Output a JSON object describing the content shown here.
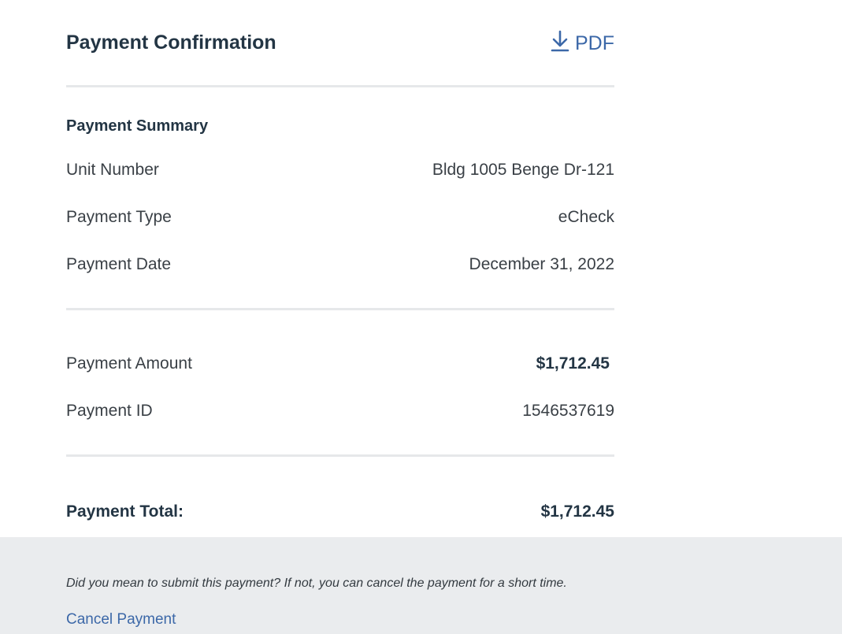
{
  "header": {
    "title": "Payment Confirmation",
    "pdf_label": "PDF"
  },
  "summary": {
    "section_title": "Payment Summary",
    "rows": [
      {
        "label": "Unit Number",
        "value": "Bldg 1005 Benge Dr-121"
      },
      {
        "label": "Payment Type",
        "value": "eCheck"
      },
      {
        "label": "Payment Date",
        "value": "December 31, 2022"
      }
    ]
  },
  "amounts": {
    "rows": [
      {
        "label": "Payment Amount",
        "value": "$1,712.45"
      },
      {
        "label": "Payment ID",
        "value": "1546537619"
      }
    ]
  },
  "total": {
    "label": "Payment Total:",
    "value": "$1,712.45"
  },
  "footer": {
    "note": "Did you mean to submit this payment? If not, you can cancel the payment for a short time.",
    "cancel_label": "Cancel Payment"
  },
  "colors": {
    "link": "#3c68a8",
    "heading": "#233544",
    "footer_bg": "#eaecee",
    "divider": "#e6e8ea"
  },
  "icons": {
    "pdf": "download-icon"
  }
}
